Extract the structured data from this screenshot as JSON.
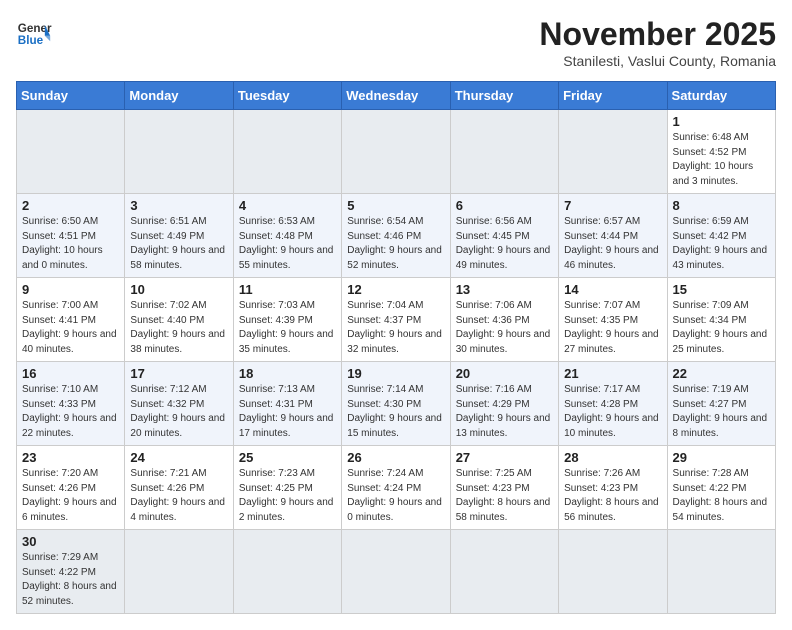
{
  "header": {
    "logo_general": "General",
    "logo_blue": "Blue",
    "month_title": "November 2025",
    "subtitle": "Stanilesti, Vaslui County, Romania"
  },
  "weekdays": [
    "Sunday",
    "Monday",
    "Tuesday",
    "Wednesday",
    "Thursday",
    "Friday",
    "Saturday"
  ],
  "weeks": [
    [
      {
        "day": "",
        "info": ""
      },
      {
        "day": "",
        "info": ""
      },
      {
        "day": "",
        "info": ""
      },
      {
        "day": "",
        "info": ""
      },
      {
        "day": "",
        "info": ""
      },
      {
        "day": "",
        "info": ""
      },
      {
        "day": "1",
        "info": "Sunrise: 6:48 AM\nSunset: 4:52 PM\nDaylight: 10 hours and 3 minutes."
      }
    ],
    [
      {
        "day": "2",
        "info": "Sunrise: 6:50 AM\nSunset: 4:51 PM\nDaylight: 10 hours and 0 minutes."
      },
      {
        "day": "3",
        "info": "Sunrise: 6:51 AM\nSunset: 4:49 PM\nDaylight: 9 hours and 58 minutes."
      },
      {
        "day": "4",
        "info": "Sunrise: 6:53 AM\nSunset: 4:48 PM\nDaylight: 9 hours and 55 minutes."
      },
      {
        "day": "5",
        "info": "Sunrise: 6:54 AM\nSunset: 4:46 PM\nDaylight: 9 hours and 52 minutes."
      },
      {
        "day": "6",
        "info": "Sunrise: 6:56 AM\nSunset: 4:45 PM\nDaylight: 9 hours and 49 minutes."
      },
      {
        "day": "7",
        "info": "Sunrise: 6:57 AM\nSunset: 4:44 PM\nDaylight: 9 hours and 46 minutes."
      },
      {
        "day": "8",
        "info": "Sunrise: 6:59 AM\nSunset: 4:42 PM\nDaylight: 9 hours and 43 minutes."
      }
    ],
    [
      {
        "day": "9",
        "info": "Sunrise: 7:00 AM\nSunset: 4:41 PM\nDaylight: 9 hours and 40 minutes."
      },
      {
        "day": "10",
        "info": "Sunrise: 7:02 AM\nSunset: 4:40 PM\nDaylight: 9 hours and 38 minutes."
      },
      {
        "day": "11",
        "info": "Sunrise: 7:03 AM\nSunset: 4:39 PM\nDaylight: 9 hours and 35 minutes."
      },
      {
        "day": "12",
        "info": "Sunrise: 7:04 AM\nSunset: 4:37 PM\nDaylight: 9 hours and 32 minutes."
      },
      {
        "day": "13",
        "info": "Sunrise: 7:06 AM\nSunset: 4:36 PM\nDaylight: 9 hours and 30 minutes."
      },
      {
        "day": "14",
        "info": "Sunrise: 7:07 AM\nSunset: 4:35 PM\nDaylight: 9 hours and 27 minutes."
      },
      {
        "day": "15",
        "info": "Sunrise: 7:09 AM\nSunset: 4:34 PM\nDaylight: 9 hours and 25 minutes."
      }
    ],
    [
      {
        "day": "16",
        "info": "Sunrise: 7:10 AM\nSunset: 4:33 PM\nDaylight: 9 hours and 22 minutes."
      },
      {
        "day": "17",
        "info": "Sunrise: 7:12 AM\nSunset: 4:32 PM\nDaylight: 9 hours and 20 minutes."
      },
      {
        "day": "18",
        "info": "Sunrise: 7:13 AM\nSunset: 4:31 PM\nDaylight: 9 hours and 17 minutes."
      },
      {
        "day": "19",
        "info": "Sunrise: 7:14 AM\nSunset: 4:30 PM\nDaylight: 9 hours and 15 minutes."
      },
      {
        "day": "20",
        "info": "Sunrise: 7:16 AM\nSunset: 4:29 PM\nDaylight: 9 hours and 13 minutes."
      },
      {
        "day": "21",
        "info": "Sunrise: 7:17 AM\nSunset: 4:28 PM\nDaylight: 9 hours and 10 minutes."
      },
      {
        "day": "22",
        "info": "Sunrise: 7:19 AM\nSunset: 4:27 PM\nDaylight: 9 hours and 8 minutes."
      }
    ],
    [
      {
        "day": "23",
        "info": "Sunrise: 7:20 AM\nSunset: 4:26 PM\nDaylight: 9 hours and 6 minutes."
      },
      {
        "day": "24",
        "info": "Sunrise: 7:21 AM\nSunset: 4:26 PM\nDaylight: 9 hours and 4 minutes."
      },
      {
        "day": "25",
        "info": "Sunrise: 7:23 AM\nSunset: 4:25 PM\nDaylight: 9 hours and 2 minutes."
      },
      {
        "day": "26",
        "info": "Sunrise: 7:24 AM\nSunset: 4:24 PM\nDaylight: 9 hours and 0 minutes."
      },
      {
        "day": "27",
        "info": "Sunrise: 7:25 AM\nSunset: 4:23 PM\nDaylight: 8 hours and 58 minutes."
      },
      {
        "day": "28",
        "info": "Sunrise: 7:26 AM\nSunset: 4:23 PM\nDaylight: 8 hours and 56 minutes."
      },
      {
        "day": "29",
        "info": "Sunrise: 7:28 AM\nSunset: 4:22 PM\nDaylight: 8 hours and 54 minutes."
      }
    ],
    [
      {
        "day": "30",
        "info": "Sunrise: 7:29 AM\nSunset: 4:22 PM\nDaylight: 8 hours and 52 minutes."
      },
      {
        "day": "",
        "info": ""
      },
      {
        "day": "",
        "info": ""
      },
      {
        "day": "",
        "info": ""
      },
      {
        "day": "",
        "info": ""
      },
      {
        "day": "",
        "info": ""
      },
      {
        "day": "",
        "info": ""
      }
    ]
  ]
}
